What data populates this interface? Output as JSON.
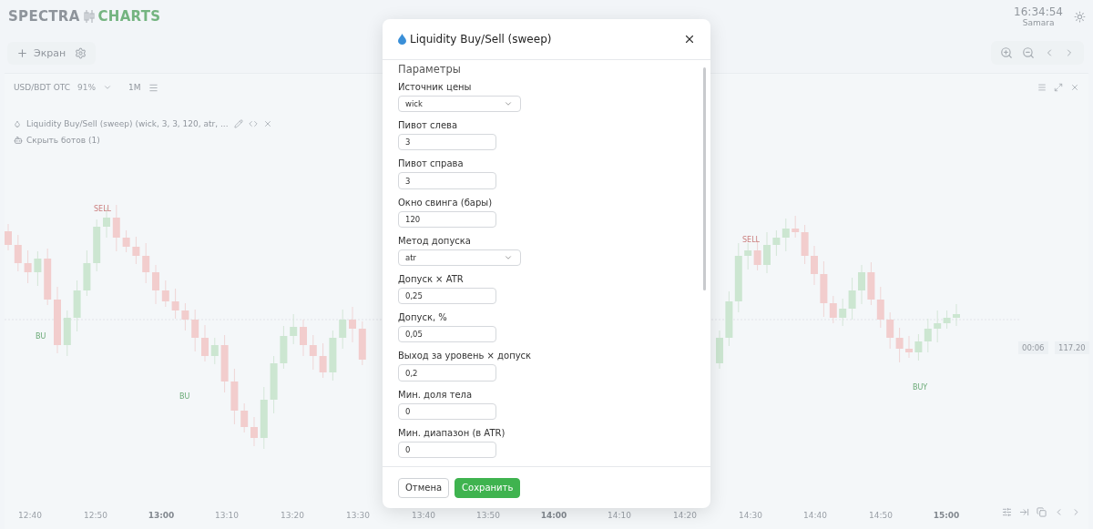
{
  "app": {
    "logo_left": "SPECTRA",
    "logo_right": "CHARTS",
    "clock": "16:34:54",
    "timezone": "Samara"
  },
  "toolbar": {
    "add_screen": "Экран"
  },
  "chart_panel": {
    "symbol": "USD/BDT OTC",
    "payout": "91%",
    "timeframe": "1M",
    "indicator": "Liquidity Buy/Sell (sweep) (wick, 3, 3, 120, atr, ...",
    "bots_toggle": "Скрыть ботов (1)",
    "signals": [
      {
        "label": "SELL",
        "kind": "sell"
      },
      {
        "label": "BU",
        "kind": "buy"
      },
      {
        "label": "BU",
        "kind": "buy"
      },
      {
        "label": "SELL",
        "kind": "sell"
      },
      {
        "label": "BUY",
        "kind": "buy"
      }
    ],
    "countdown": "00:06",
    "price": "117.20",
    "time_axis": [
      {
        "label": "12:40",
        "bold": false
      },
      {
        "label": "12:50",
        "bold": false
      },
      {
        "label": "13:00",
        "bold": true
      },
      {
        "label": "13:10",
        "bold": false
      },
      {
        "label": "13:20",
        "bold": false
      },
      {
        "label": "13:30",
        "bold": false
      },
      {
        "label": "13:40",
        "bold": false
      },
      {
        "label": "13:50",
        "bold": false
      },
      {
        "label": "14:00",
        "bold": true
      },
      {
        "label": "14:10",
        "bold": false
      },
      {
        "label": "14:20",
        "bold": false
      },
      {
        "label": "14:30",
        "bold": false
      },
      {
        "label": "14:40",
        "bold": false
      },
      {
        "label": "14:50",
        "bold": false
      },
      {
        "label": "15:00",
        "bold": true
      }
    ]
  },
  "dialog": {
    "title": "Liquidity Buy/Sell (sweep)",
    "section": "Параметры",
    "fields": [
      {
        "label": "Источник цены",
        "kind": "select",
        "value": "wick"
      },
      {
        "label": "Пивот слева",
        "kind": "input",
        "value": "3"
      },
      {
        "label": "Пивот справа",
        "kind": "input",
        "value": "3"
      },
      {
        "label": "Окно свинга (бары)",
        "kind": "input",
        "value": "120"
      },
      {
        "label": "Метод допуска",
        "kind": "select",
        "value": "atr"
      },
      {
        "label": "Допуск × ATR",
        "kind": "input",
        "value": "0,25"
      },
      {
        "label": "Допуск, %",
        "kind": "input",
        "value": "0,05"
      },
      {
        "label": "Выход за уровень × допуск",
        "kind": "input",
        "value": "0,2"
      },
      {
        "label": "Мин. доля тела",
        "kind": "input",
        "value": "0"
      },
      {
        "label": "Мин. диапазон (в ATR)",
        "kind": "input",
        "value": "0"
      }
    ],
    "buttons": [
      {
        "label": "Отмена",
        "kind": "secondary"
      },
      {
        "label": "Сохранить",
        "kind": "primary"
      }
    ]
  }
}
